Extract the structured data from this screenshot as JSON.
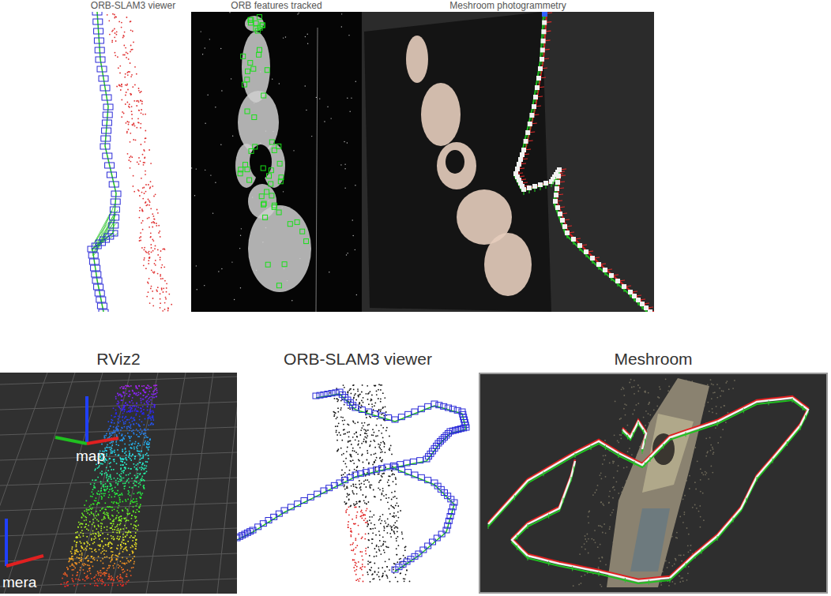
{
  "figure_top": {
    "panels": [
      {
        "title": "ORB-SLAM3 viewer"
      },
      {
        "title": "ORB features tracked"
      },
      {
        "title": "Meshroom photogrammetry"
      }
    ]
  },
  "figure_bottom": {
    "panels": [
      {
        "title": "RViz2",
        "labels": [
          "map",
          "mera"
        ]
      },
      {
        "title": "ORB-SLAM3 viewer"
      },
      {
        "title": "Meshroom"
      }
    ]
  }
}
